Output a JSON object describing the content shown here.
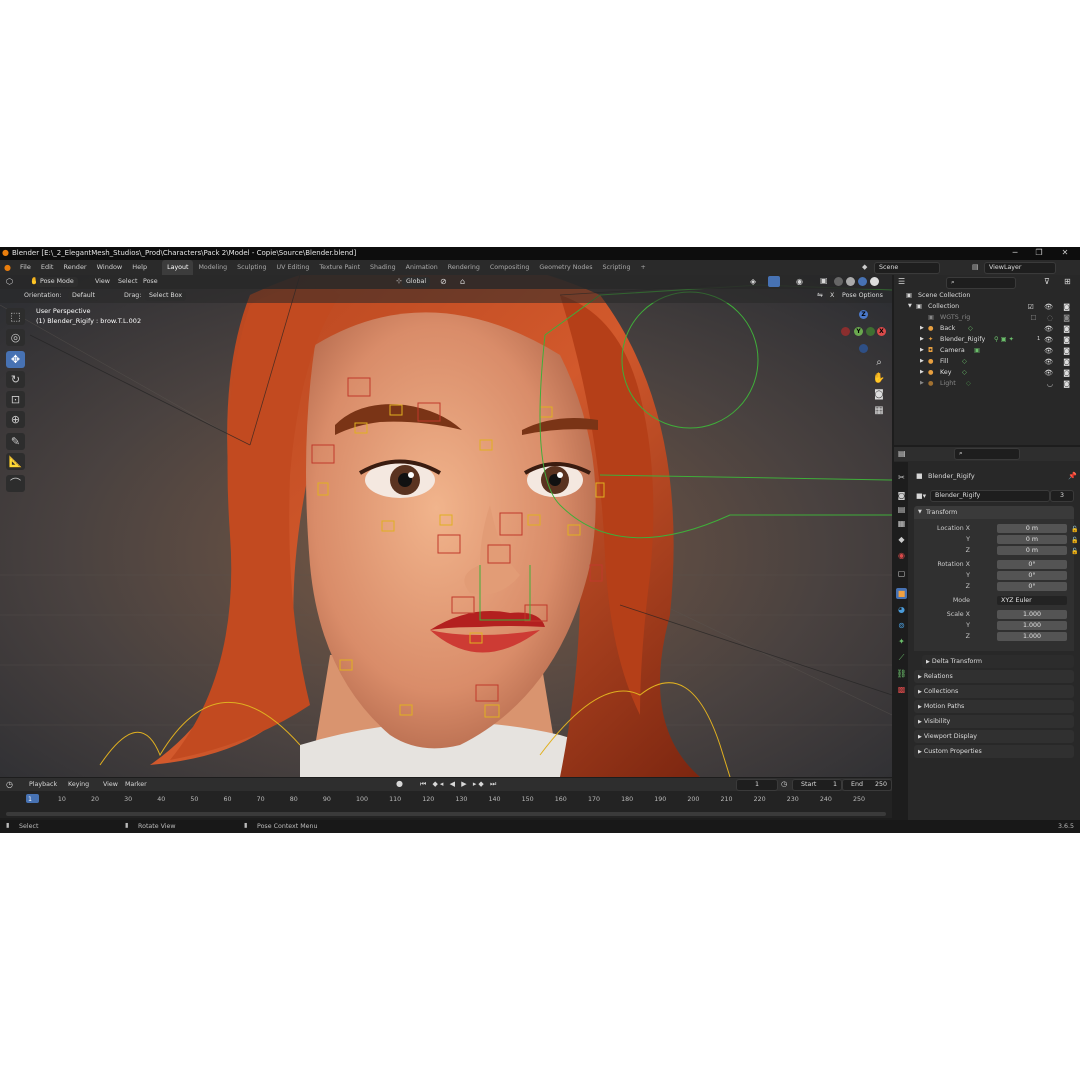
{
  "window": {
    "title": "Blender [E:\\_2_ElegantMesh_Studios\\_Prod\\Characters\\Pack 2\\Model - Copie\\Source\\Blender.blend]",
    "minimize": "─",
    "maximize": "❐",
    "close": "✕"
  },
  "menubar": {
    "menus": [
      "File",
      "Edit",
      "Render",
      "Window",
      "Help"
    ],
    "workspaces": [
      "Layout",
      "Modeling",
      "Sculpting",
      "UV Editing",
      "Texture Paint",
      "Shading",
      "Animation",
      "Rendering",
      "Compositing",
      "Geometry Nodes",
      "Scripting"
    ],
    "add_workspace": "+",
    "scene": "Scene",
    "view_layer": "ViewLayer"
  },
  "viewport": {
    "mode": "Pose Mode",
    "menus": [
      "View",
      "Select",
      "Pose"
    ],
    "transform_orientation": "Global",
    "orientation_label": "Orientation:",
    "orientation_value": "Default",
    "drag_label": "Drag:",
    "drag_value": "Select Box",
    "pose_options": "Pose Options",
    "x_toggle": "X",
    "info_line1": "User Perspective",
    "info_line2": "(1) Blender_Rigify : brow.T.L.002",
    "gizmo": {
      "z": "Z",
      "y": "Y",
      "x": "X"
    }
  },
  "outliner": {
    "root": "Scene Collection",
    "items": [
      {
        "label": "Collection",
        "depth": 1
      },
      {
        "label": "WGTS_rig",
        "depth": 2
      },
      {
        "label": "Back",
        "depth": 2
      },
      {
        "label": "Blender_Rigify",
        "depth": 2
      },
      {
        "label": "Camera",
        "depth": 2
      },
      {
        "label": "Fill",
        "depth": 2
      },
      {
        "label": "Key",
        "depth": 2
      },
      {
        "label": "Light",
        "depth": 2
      }
    ],
    "rigify_badge": "1"
  },
  "properties": {
    "object_name": "Blender_Rigify",
    "data_name": "Blender_Rigify",
    "data_users": "3",
    "transform_panel": "Transform",
    "location": {
      "label": "Location X",
      "x": "0 m",
      "y": "0 m",
      "z": "0 m"
    },
    "rotation": {
      "label": "Rotation X",
      "x": "0°",
      "y": "0°",
      "z": "0°"
    },
    "mode_label": "Mode",
    "mode_value": "XYZ Euler",
    "scale": {
      "label": "Scale X",
      "x": "1.000",
      "y": "1.000",
      "z": "1.000"
    },
    "axis_y": "Y",
    "axis_z": "Z",
    "delta": "Delta Transform",
    "panels": [
      "Relations",
      "Collections",
      "Motion Paths",
      "Visibility",
      "Viewport Display",
      "Custom Properties"
    ]
  },
  "timeline": {
    "menus": [
      "Playback",
      "Keying",
      "View",
      "Marker"
    ],
    "current_frame": "1",
    "start_label": "Start",
    "start_value": "1",
    "end_label": "End",
    "end_value": "250",
    "ticks": [
      "1",
      "10",
      "20",
      "30",
      "40",
      "50",
      "60",
      "70",
      "80",
      "90",
      "100",
      "110",
      "120",
      "130",
      "140",
      "150",
      "160",
      "170",
      "180",
      "190",
      "200",
      "210",
      "220",
      "230",
      "240",
      "250"
    ]
  },
  "statusbar": {
    "select": "Select",
    "rotate": "Rotate View",
    "context": "Pose Context Menu",
    "version": "3.6.5"
  },
  "colors": {
    "accent_blue": "#4772b3",
    "bone_yellow": "#e0b020",
    "bone_red": "#c0392b",
    "bone_green": "#3fae3a"
  }
}
